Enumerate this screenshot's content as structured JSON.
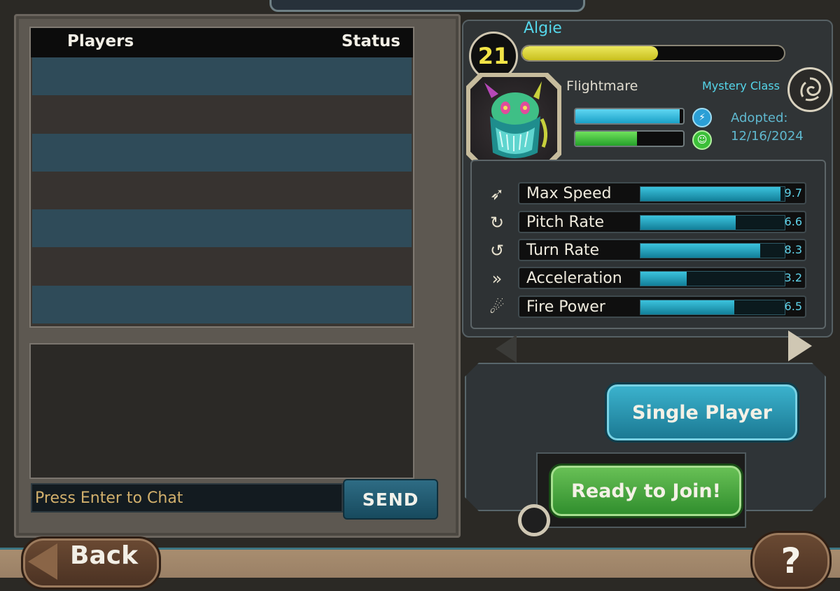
{
  "players": {
    "header_players": "Players",
    "header_status": "Status",
    "rows": [
      "",
      "",
      "",
      "",
      "",
      "",
      ""
    ]
  },
  "chat": {
    "placeholder": "Press Enter to Chat",
    "send_label": "SEND"
  },
  "dragon": {
    "name": "Algie",
    "level": "21",
    "xp_fraction": 0.52,
    "species": "Flightmare",
    "class": "Mystery Class",
    "energy_fraction": 0.97,
    "happiness_fraction": 0.57,
    "adopted_label": "Adopted:",
    "adopted_date": "12/16/2024"
  },
  "stats": [
    {
      "label": "Max Speed",
      "value": "9.7",
      "icon": "max-speed-icon"
    },
    {
      "label": "Pitch Rate",
      "value": "6.6",
      "icon": "pitch-rate-icon"
    },
    {
      "label": "Turn Rate",
      "value": "8.3",
      "icon": "turn-rate-icon"
    },
    {
      "label": "Acceleration",
      "value": "3.2",
      "icon": "acceleration-icon"
    },
    {
      "label": "Fire Power",
      "value": "6.5",
      "icon": "fire-power-icon"
    }
  ],
  "modes": {
    "single_player": "Single Player",
    "ready": "Ready to Join!"
  },
  "nav": {
    "back": "Back",
    "help": "?"
  },
  "colors": {
    "accent_cyan": "#55d6ea",
    "xp_yellow": "#e6e04a",
    "energy_blue": "#3cc4e6",
    "happy_green": "#4cc943",
    "ready_green": "#4ea73f",
    "single_blue": "#2a96b3"
  }
}
